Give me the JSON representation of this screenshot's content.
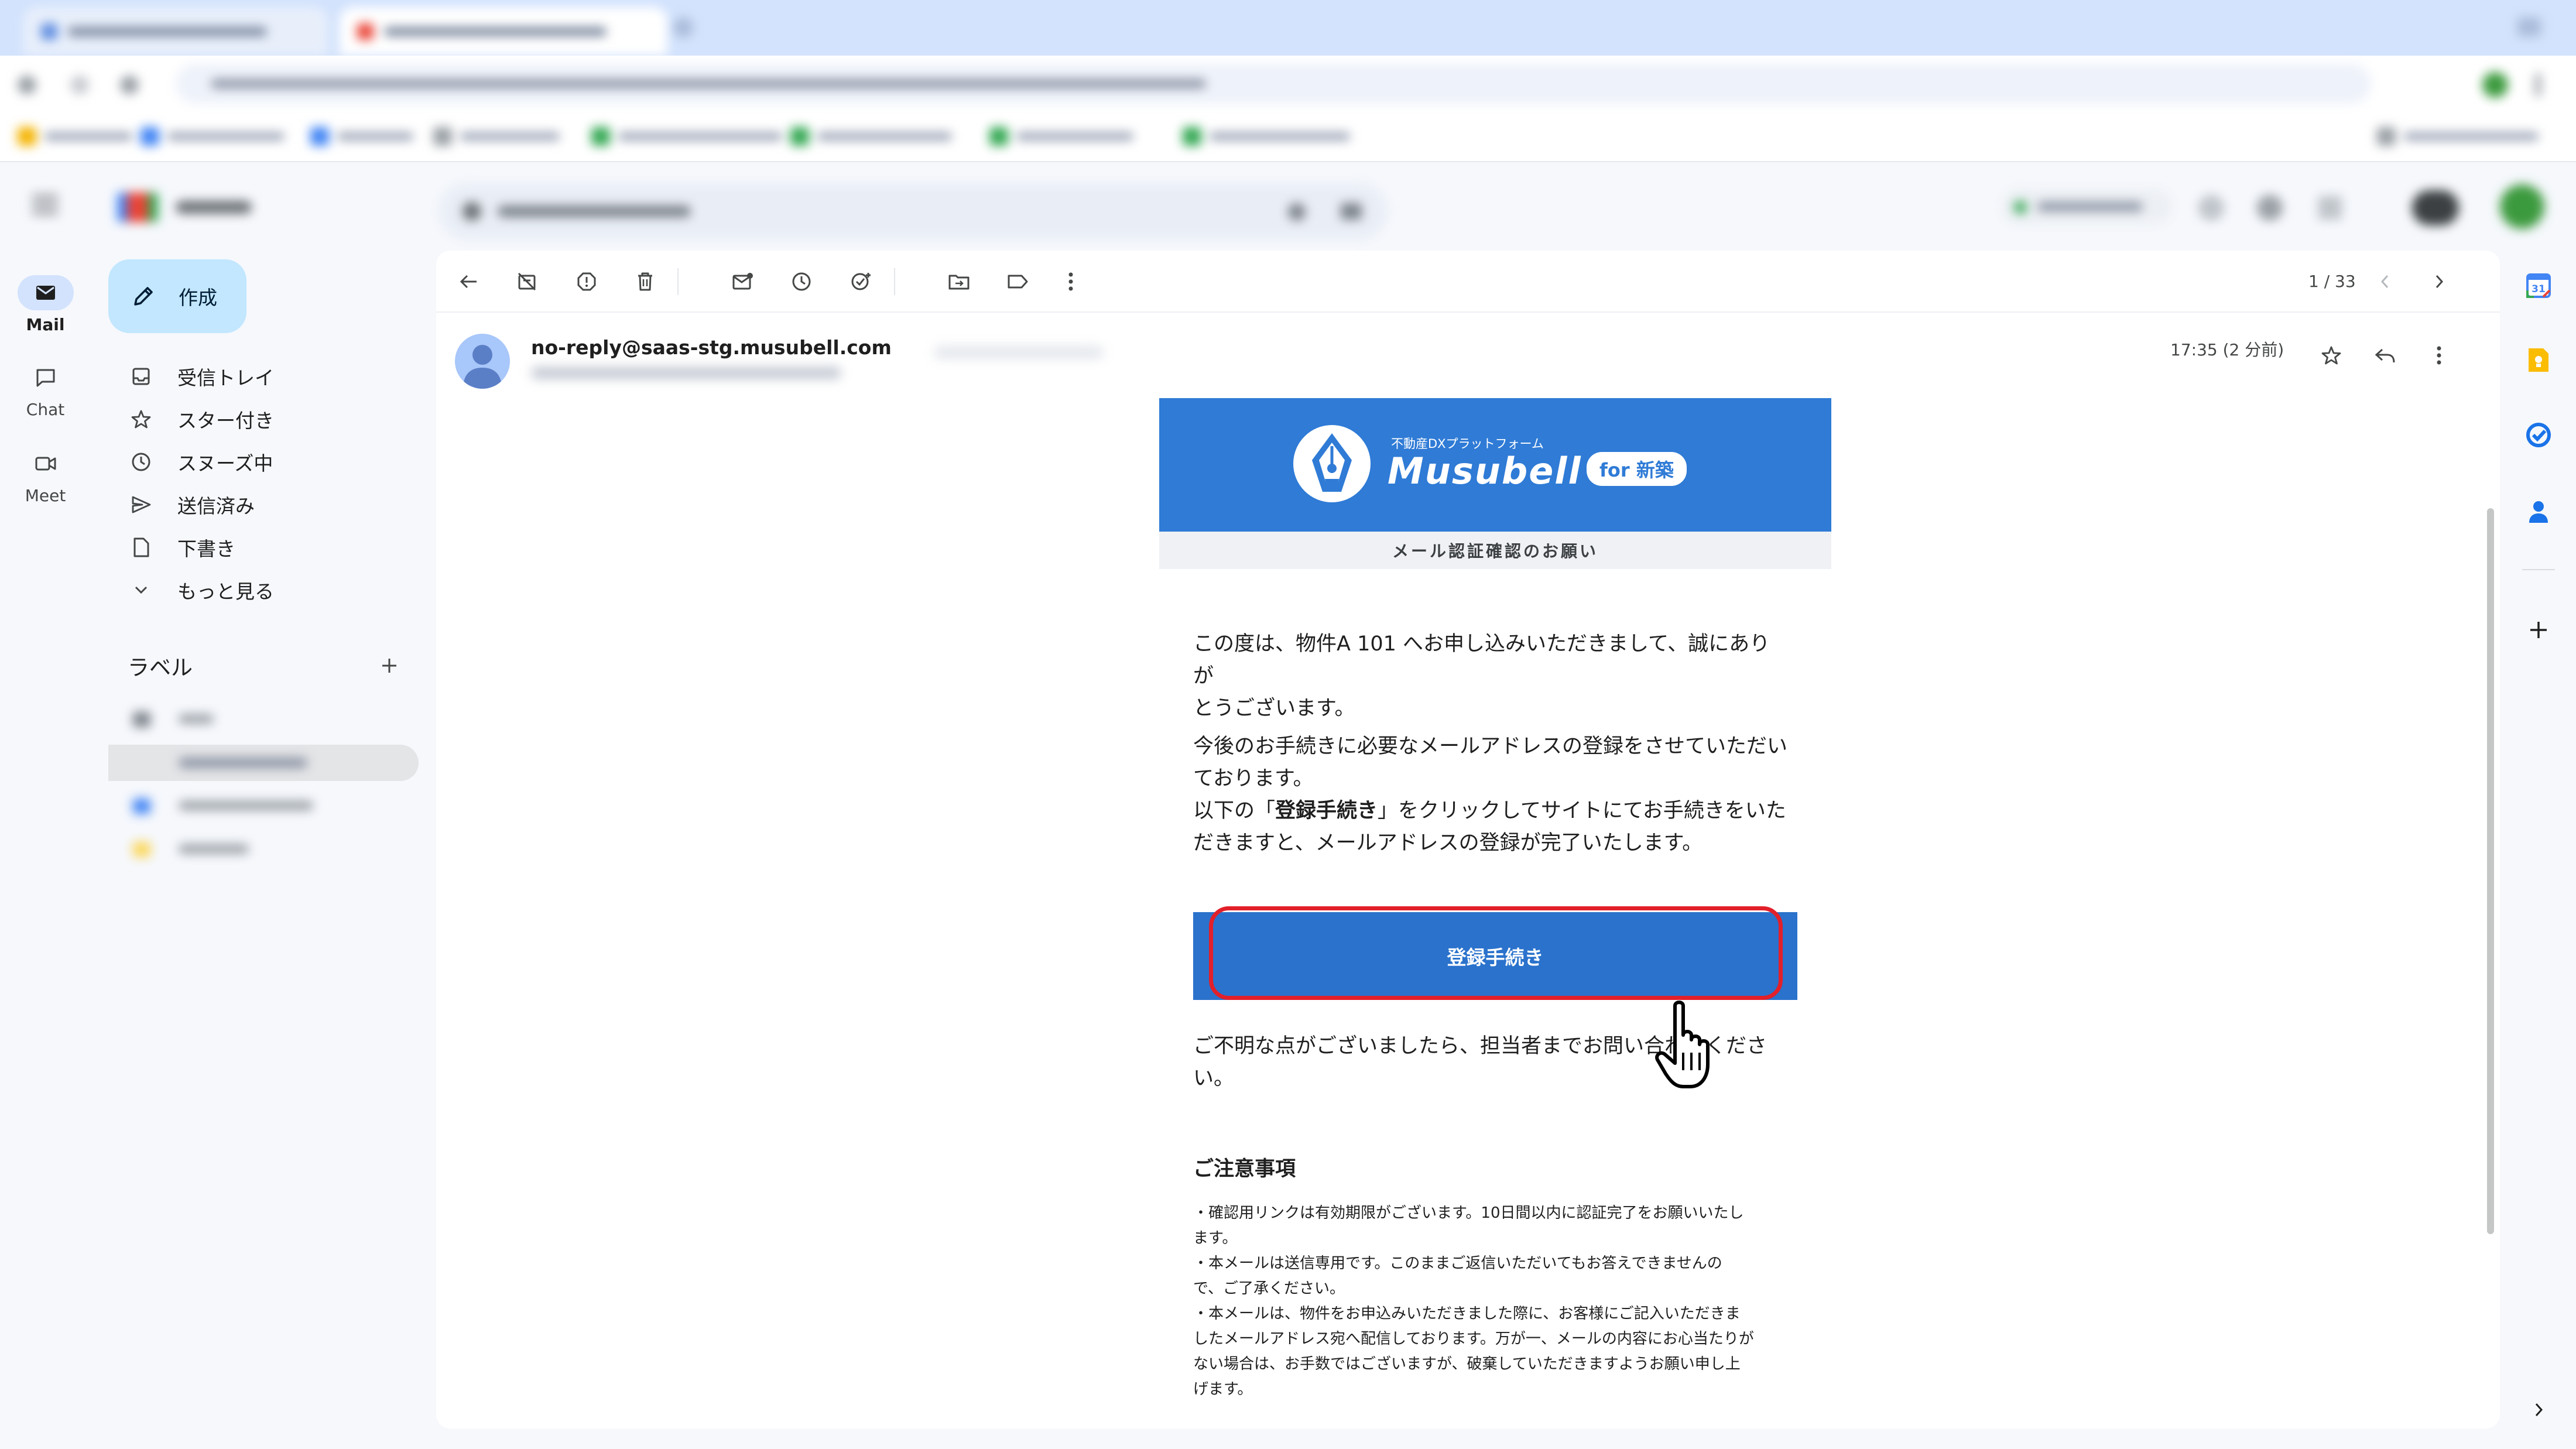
{
  "rail": {
    "mail_label": "Mail",
    "chat_label": "Chat",
    "meet_label": "Meet"
  },
  "compose": {
    "label": "作成"
  },
  "nav": {
    "items": [
      {
        "label": "受信トレイ",
        "icon": "inbox-icon"
      },
      {
        "label": "スター付き",
        "icon": "star-icon"
      },
      {
        "label": "スヌーズ中",
        "icon": "clock-icon"
      },
      {
        "label": "送信済み",
        "icon": "send-icon"
      },
      {
        "label": "下書き",
        "icon": "draft-icon"
      },
      {
        "label": "もっと見る",
        "icon": "chevron-down-icon"
      }
    ]
  },
  "labels": {
    "heading": "ラベル"
  },
  "pager": {
    "counter": "1 / 33"
  },
  "message": {
    "sender": "no-reply@saas-stg.musubell.com",
    "time": "17:35 (2 分前)"
  },
  "email": {
    "brand_tagline": "不動産DXプラットフォーム",
    "brand_name": "Musubell",
    "brand_badge": "for 新築",
    "subtitle": "メール認証確認のお願い",
    "para1_line1": "この度は、物件A 101 へお申し込みいただきまして、誠にありが",
    "para1_line2": "とうございます。",
    "para2_line1": "今後のお手続きに必要なメールアドレスの登録をさせていただい",
    "para2_line2": "ております。",
    "para3_pre": "以下の「",
    "para3_bold": "登録手続き",
    "para3_post": "」をクリックしてサイトにてお手続きをいた",
    "para3_line2": "だきますと、メールアドレスの登録が完了いたします。",
    "button_label": "登録手続き",
    "contact_line1": "ご不明な点がございましたら、担当者までお問い合わせくださ",
    "contact_line2": "い。",
    "notes_heading": "ご注意事項",
    "notes_lines": [
      "・確認用リンクは有効期限がございます。10日間以内に認証完了をお願いいたし",
      "ます。",
      "・本メールは送信専用です。このままご返信いただいてもお答えできませんの",
      "で、ご了承ください。",
      "・本メールは、物件をお申込みいただきました際に、お客様にご記入いただきま",
      "したメールアドレス宛へ配信しております。万が一、メールの内容にお心当たりが",
      "ない場合は、お手数ではございますが、破棄していただきますようお願い申し上",
      "げます。"
    ]
  },
  "side_panel": {
    "calendar_day": "31",
    "apps": [
      "calendar-icon",
      "keep-icon",
      "tasks-icon",
      "contacts-icon",
      "plus-icon"
    ]
  },
  "colors": {
    "brand_blue": "#2f7bd6",
    "button_blue": "#2a72cc",
    "highlight_red": "#e2202a",
    "compose_bg": "#c2e7ff"
  }
}
